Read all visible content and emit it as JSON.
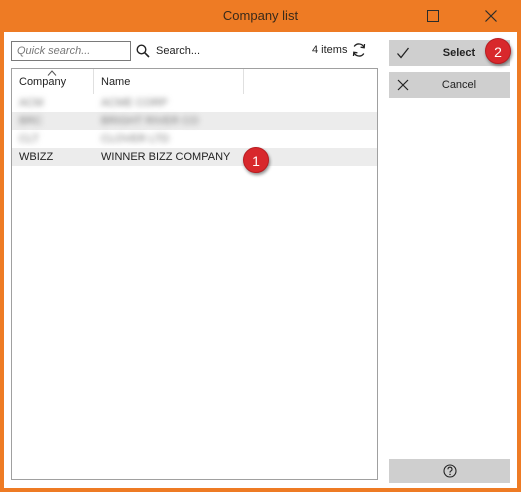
{
  "window": {
    "title": "Company list",
    "accent_color": "#ee7b24",
    "maximize_icon": "maximize-icon",
    "close_icon": "close-icon"
  },
  "toolbar": {
    "search_placeholder": "Quick search...",
    "search_value": "",
    "search_label": "Search...",
    "search_icon": "magnifier-icon",
    "items_count": "4 items",
    "refresh_icon": "refresh-icon"
  },
  "grid": {
    "columns": [
      "Company",
      "Name"
    ],
    "sorted_column": "Company",
    "rows": [
      {
        "company": "ACM",
        "name": "ACME CORP",
        "blurred": true
      },
      {
        "company": "BRC",
        "name": "BRIGHT RIVER CO",
        "blurred": true
      },
      {
        "company": "CLT",
        "name": "CLOVER LTD",
        "blurred": true
      },
      {
        "company": "WBIZZ",
        "name": "WINNER BIZZ COMPANY",
        "blurred": false
      }
    ]
  },
  "actions": {
    "select_label": "Select",
    "select_icon": "checkmark-icon",
    "cancel_label": "Cancel",
    "cancel_icon": "x-icon",
    "help_icon": "question-circle-icon"
  },
  "annotations": {
    "badge_1": "1",
    "badge_2": "2",
    "badge_color": "#d8282c"
  }
}
